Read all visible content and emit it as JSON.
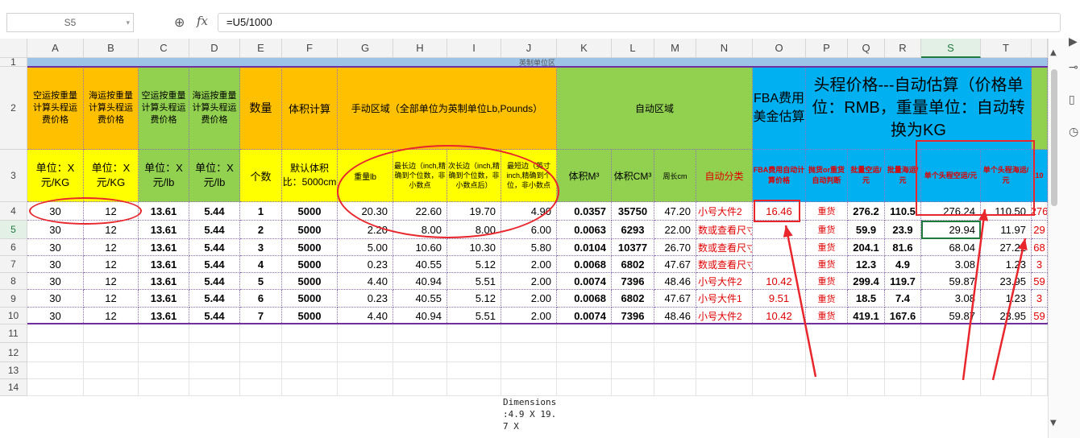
{
  "formula_bar": {
    "name_box": "S5",
    "fx": "fx",
    "formula": "=U5/1000"
  },
  "columns": [
    "A",
    "B",
    "C",
    "D",
    "E",
    "F",
    "G",
    "H",
    "I",
    "J",
    "K",
    "L",
    "M",
    "N",
    "O",
    "P",
    "Q",
    "R",
    "S",
    "T"
  ],
  "selected_column": "S",
  "row_numbers": [
    "1",
    "2",
    "3",
    "4",
    "5",
    "6",
    "7",
    "8",
    "9",
    "10",
    "11",
    "12",
    "13",
    "14"
  ],
  "selected_row": "5",
  "row1_band": "英制单位区",
  "header2": {
    "A": "空运按重量计算头程运费价格",
    "B": "海运按重量计算头程运费价格",
    "C": "空运按重量计算头程运费价格",
    "D": "海运按重量计算头程运费价格",
    "E": "数量",
    "F": "体积计算",
    "GJ": "手动区域（全部单位为英制单位Lb,Pounds）",
    "KN": "自动区域",
    "O": "FBA费用美金估算",
    "PT": "头程价格---自动估算（价格单位：RMB，重量单位：自动转换为KG"
  },
  "header3": {
    "A": "单位：X元/KG",
    "B": "单位：X元/KG",
    "C": "单位：X元/lb",
    "D": "单位：X元/lb",
    "E": "个数",
    "F": "默认体积比：5000cm",
    "G": "重量lb",
    "H": "最长边（inch,精确到个位数，非小数点",
    "I": "次长边（inch,精确到个位数，非小数点后）",
    "J": "最短边（英寸inch,精确到个位，非小数点",
    "K": "体积M³",
    "L": "体积CM³",
    "M": "周长cm",
    "N": "自动分类",
    "O": "FBA费用自动计算价格",
    "P": "抛货or重货自动判断",
    "Q": "批量空运/元",
    "R": "批量海运/元",
    "S": "单个头程空运/元",
    "T": "单个头程海运/元",
    "U": "10"
  },
  "rows": [
    {
      "row": "4",
      "A": "30",
      "B": "12",
      "C": "13.61",
      "D": "5.44",
      "E": "1",
      "F": "5000",
      "G": "20.30",
      "H": "22.60",
      "I": "19.70",
      "J": "4.90",
      "K": "0.0357",
      "L": "35750",
      "M": "47.20",
      "N": "小号大件2",
      "O": "16.46",
      "P": "重货",
      "Q": "276.2",
      "R": "110.5",
      "S": "276.24",
      "T": "110.50",
      "U": "276"
    },
    {
      "row": "5",
      "A": "30",
      "B": "12",
      "C": "13.61",
      "D": "5.44",
      "E": "2",
      "F": "5000",
      "G": "2.20",
      "H": "8.00",
      "I": "8.00",
      "J": "6.00",
      "K": "0.0063",
      "L": "6293",
      "M": "22.00",
      "N": "数或查看尺寸或重量是否",
      "O": "",
      "P": "重货",
      "Q": "59.9",
      "R": "23.9",
      "S": "29.94",
      "T": "11.97",
      "U": "29"
    },
    {
      "row": "6",
      "A": "30",
      "B": "12",
      "C": "13.61",
      "D": "5.44",
      "E": "3",
      "F": "5000",
      "G": "5.00",
      "H": "10.60",
      "I": "10.30",
      "J": "5.80",
      "K": "0.0104",
      "L": "10377",
      "M": "26.70",
      "N": "数或查看尺寸或重量是否",
      "O": "",
      "P": "重货",
      "Q": "204.1",
      "R": "81.6",
      "S": "68.04",
      "T": "27.22",
      "U": "68"
    },
    {
      "row": "7",
      "A": "30",
      "B": "12",
      "C": "13.61",
      "D": "5.44",
      "E": "4",
      "F": "5000",
      "G": "0.23",
      "H": "40.55",
      "I": "5.12",
      "J": "2.00",
      "K": "0.0068",
      "L": "6802",
      "M": "47.67",
      "N": "数或查看尺寸或重量是否",
      "O": "",
      "P": "重货",
      "Q": "12.3",
      "R": "4.9",
      "S": "3.08",
      "T": "1.23",
      "U": "3"
    },
    {
      "row": "8",
      "A": "30",
      "B": "12",
      "C": "13.61",
      "D": "5.44",
      "E": "5",
      "F": "5000",
      "G": "4.40",
      "H": "40.94",
      "I": "5.51",
      "J": "2.00",
      "K": "0.0074",
      "L": "7396",
      "M": "48.46",
      "N": "小号大件2",
      "O": "10.42",
      "P": "重货",
      "Q": "299.4",
      "R": "119.7",
      "S": "59.87",
      "T": "23.95",
      "U": "59"
    },
    {
      "row": "9",
      "A": "30",
      "B": "12",
      "C": "13.61",
      "D": "5.44",
      "E": "6",
      "F": "5000",
      "G": "0.23",
      "H": "40.55",
      "I": "5.12",
      "J": "2.00",
      "K": "0.0068",
      "L": "6802",
      "M": "47.67",
      "N": "小号大件1",
      "O": "9.51",
      "P": "重货",
      "Q": "18.5",
      "R": "7.4",
      "S": "3.08",
      "T": "1.23",
      "U": "3"
    },
    {
      "row": "10",
      "A": "30",
      "B": "12",
      "C": "13.61",
      "D": "5.44",
      "E": "7",
      "F": "5000",
      "G": "4.40",
      "H": "40.94",
      "I": "5.51",
      "J": "2.00",
      "K": "0.0074",
      "L": "7396",
      "M": "48.46",
      "N": "小号大件2",
      "O": "10.42",
      "P": "重货",
      "Q": "419.1",
      "R": "167.6",
      "S": "59.87",
      "T": "23.95",
      "U": "59"
    }
  ],
  "paste_text": "Dimensions :4.9 X 19.7 X",
  "colors": {
    "orange": "#ffc000",
    "green": "#92d050",
    "yellow": "#ffff00",
    "cyan": "#00b0f0",
    "annotation": "#e8262c"
  }
}
